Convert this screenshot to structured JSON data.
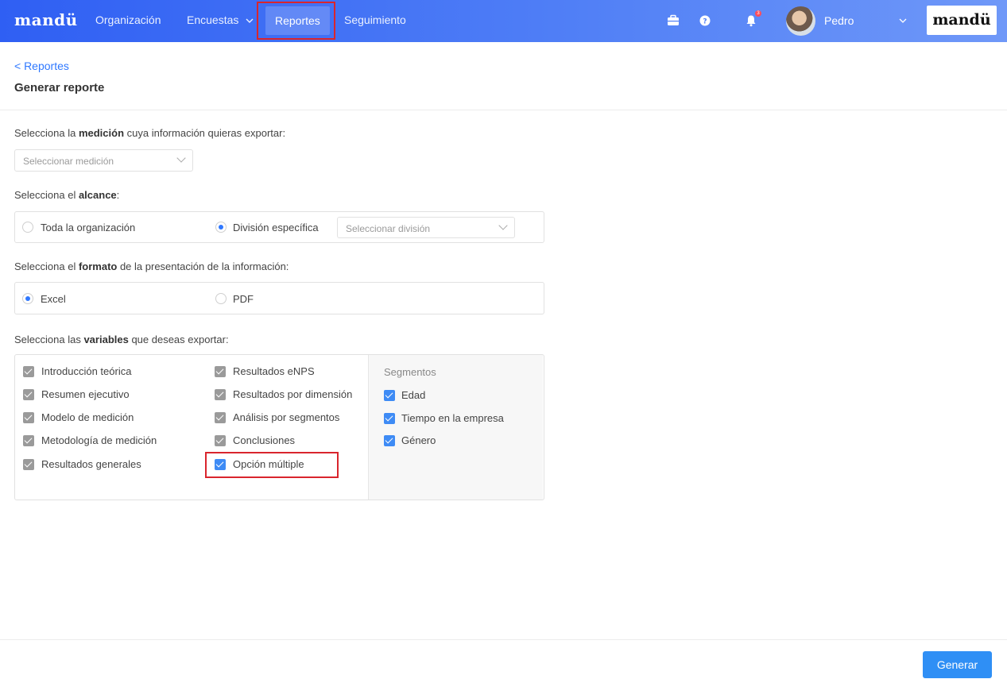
{
  "nav": {
    "logo": "mandü",
    "items": [
      "Organización",
      "Encuestas",
      "Reportes",
      "Seguimiento"
    ],
    "encuestas_chevron": "chevron-down-icon",
    "notifications_count": "3",
    "user_name": "Pedro",
    "brand_box": "mandü",
    "icons": [
      "briefcase-icon",
      "help-icon",
      "bell-icon"
    ]
  },
  "header": {
    "back_link": "< Reportes",
    "title": "Generar reporte"
  },
  "medicion": {
    "label_pre": "Selecciona la ",
    "label_bold": "medición",
    "label_post": " cuya información quieras exportar:",
    "select_placeholder": "Seleccionar medición"
  },
  "alcance": {
    "label_pre": "Selecciona el ",
    "label_bold": "alcance",
    "label_post": ":",
    "options": [
      "Toda la organización",
      "División específica"
    ],
    "selected": "División específica",
    "division_placeholder": "Seleccionar división"
  },
  "formato": {
    "label_pre": "Selecciona el ",
    "label_bold": "formato",
    "label_post": " de la presentación de la información:",
    "options": [
      "Excel",
      "PDF"
    ],
    "selected": "Excel"
  },
  "variables": {
    "label_pre": "Selecciona las ",
    "label_bold": "variables",
    "label_post": " que deseas exportar:",
    "col1": [
      "Introducción teórica",
      "Resumen ejecutivo",
      "Modelo de medición",
      "Metodología de medición",
      "Resultados generales"
    ],
    "col2": [
      "Resultados eNPS",
      "Resultados por dimensión",
      "Análisis por segmentos",
      "Conclusiones",
      "Opción múltiple"
    ],
    "segments_title": "Segmentos",
    "segments": [
      "Edad",
      "Tiempo en la empresa",
      "Género"
    ]
  },
  "footer": {
    "generate_label": "Generar"
  },
  "colors": {
    "nav_gradient_start": "#2f5ff3",
    "nav_gradient_end": "#6f98f8",
    "accent": "#2f78ff",
    "highlight": "#d9252d",
    "checkbox_disabled": "#9a9a9a",
    "checkbox_active": "#3e8bf5"
  }
}
